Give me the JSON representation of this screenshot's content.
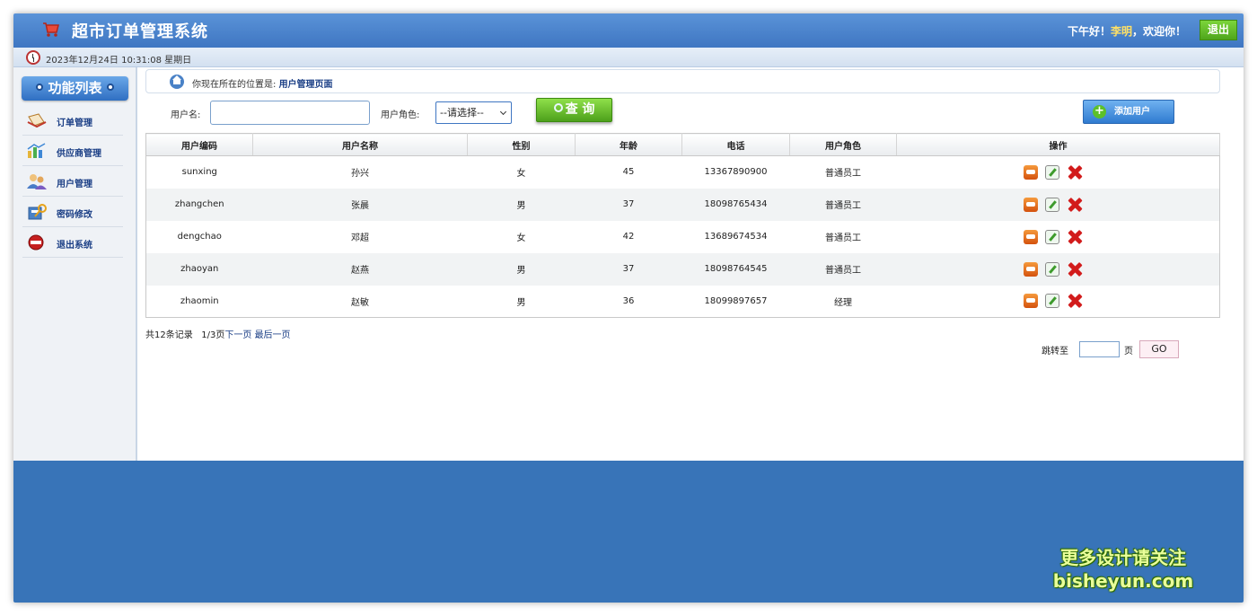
{
  "header": {
    "title": "超市订单管理系统",
    "greeting_prefix": "下午好！",
    "user_name": "李明",
    "greeting_suffix": "，欢迎你！",
    "logout_label": "退出"
  },
  "datebar": {
    "datetime": "2023年12月24日 10:31:08 星期日"
  },
  "sidebar": {
    "header": "功能列表",
    "items": [
      {
        "label": "订单管理",
        "icon": "order-icon"
      },
      {
        "label": "供应商管理",
        "icon": "supplier-icon"
      },
      {
        "label": "用户管理",
        "icon": "users-icon"
      },
      {
        "label": "密码修改",
        "icon": "password-icon"
      },
      {
        "label": "退出系统",
        "icon": "exit-icon"
      }
    ]
  },
  "location": {
    "prefix": "你现在所在的位置是:",
    "page": "用户管理页面"
  },
  "search": {
    "username_label": "用户名:",
    "username_value": "",
    "role_label": "用户角色:",
    "role_selected": "--请选择--",
    "query_label": "查 询",
    "add_label": "添加用户"
  },
  "table": {
    "headers": [
      "用户编码",
      "用户名称",
      "性别",
      "年龄",
      "电话",
      "用户角色",
      "操作"
    ],
    "rows": [
      {
        "code": "sunxing",
        "name": "孙兴",
        "gender": "女",
        "age": "45",
        "phone": "13367890900",
        "role": "普通员工"
      },
      {
        "code": "zhangchen",
        "name": "张晨",
        "gender": "男",
        "age": "37",
        "phone": "18098765434",
        "role": "普通员工"
      },
      {
        "code": "dengchao",
        "name": "邓超",
        "gender": "女",
        "age": "42",
        "phone": "13689674534",
        "role": "普通员工"
      },
      {
        "code": "zhaoyan",
        "name": "赵燕",
        "gender": "男",
        "age": "37",
        "phone": "18098764545",
        "role": "普通员工"
      },
      {
        "code": "zhaomin",
        "name": "赵敏",
        "gender": "男",
        "age": "36",
        "phone": "18099897657",
        "role": "经理"
      }
    ]
  },
  "pager": {
    "total": "共12条记录",
    "page_info": "1/3页",
    "next": "下一页",
    "last": "最后一页",
    "jump_label": "跳转至",
    "jump_value": "",
    "unit": "页",
    "go_label": "GO"
  },
  "watermark": {
    "line1": "更多设计请关注",
    "line2": "bisheyun.com"
  }
}
